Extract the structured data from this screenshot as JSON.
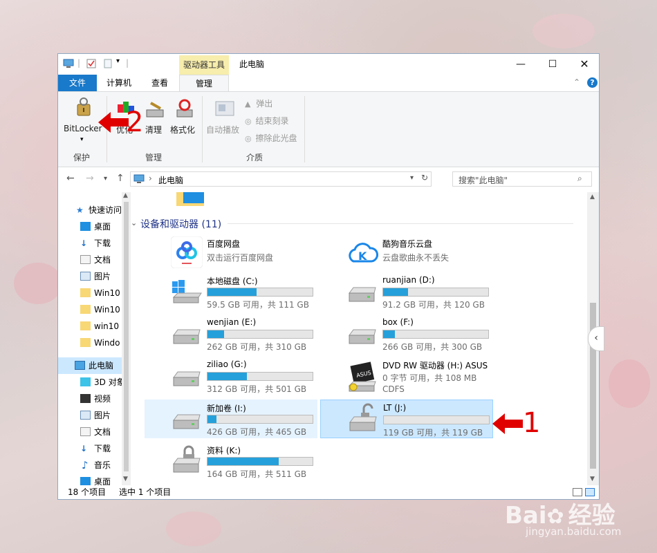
{
  "window": {
    "title": "此电脑",
    "context_tab": "驱动器工具"
  },
  "tabs": [
    {
      "label": "文件"
    },
    {
      "label": "计算机"
    },
    {
      "label": "查看"
    },
    {
      "label": "管理"
    }
  ],
  "ribbon": {
    "bitlocker": "BitLocker",
    "optimize": "优化",
    "cleanup": "清理",
    "format": "格式化",
    "autoplay": "自动播放",
    "eject": "弹出",
    "finish_burn": "结束刻录",
    "erase_disc": "擦除此光盘",
    "group_protect": "保护",
    "group_manage": "管理",
    "group_media": "介质"
  },
  "address": {
    "path": "此电脑",
    "search_placeholder": "搜索\"此电脑\""
  },
  "nav": {
    "items": [
      {
        "label": "快速访问"
      },
      {
        "label": "桌面"
      },
      {
        "label": "下载"
      },
      {
        "label": "文档"
      },
      {
        "label": "图片"
      },
      {
        "label": "Win10"
      },
      {
        "label": "Win10"
      },
      {
        "label": "win10"
      },
      {
        "label": "Windo"
      },
      {
        "label": "此电脑"
      },
      {
        "label": "3D 对象"
      },
      {
        "label": "视频"
      },
      {
        "label": "图片"
      },
      {
        "label": "文档"
      },
      {
        "label": "下载"
      },
      {
        "label": "音乐"
      },
      {
        "label": "桌面"
      }
    ]
  },
  "group": {
    "title": "设备和驱动器 (11)"
  },
  "drives": [
    {
      "name": "百度网盘",
      "sub": "双击运行百度网盘"
    },
    {
      "name": "酷狗音乐云盘",
      "sub": "云盘歌曲永不丢失"
    },
    {
      "name": "本地磁盘 (C:)",
      "sub": "59.5 GB 可用，共 111 GB",
      "used": 0.464
    },
    {
      "name": "ruanjian (D:)",
      "sub": "91.2 GB 可用，共 120 GB",
      "used": 0.24
    },
    {
      "name": "wenjian (E:)",
      "sub": "262 GB 可用，共 310 GB",
      "used": 0.155
    },
    {
      "name": "box (F:)",
      "sub": "266 GB 可用，共 300 GB",
      "used": 0.113
    },
    {
      "name": "ziliao (G:)",
      "sub": "312 GB 可用，共 501 GB",
      "used": 0.377
    },
    {
      "name": "DVD RW 驱动器 (H:) ASUS",
      "sub": "0 字节 可用，共 108 MB",
      "sub2": "CDFS"
    },
    {
      "name": "新加卷 (I:)",
      "sub": "426 GB 可用，共 465 GB",
      "used": 0.084
    },
    {
      "name": "LT (J:)",
      "sub": "119 GB 可用，共 119 GB",
      "used": 0.0
    },
    {
      "name": "资料 (K:)",
      "sub": "164 GB 可用，共 511 GB",
      "used": 0.679
    }
  ],
  "status": {
    "count": "18 个项目",
    "selected": "选中 1 个项目"
  },
  "annotations": {
    "label1": "1",
    "label2": "2"
  },
  "watermark": {
    "brand": "Bai",
    "brand2": "经验",
    "url": "jingyan.baidu.com"
  },
  "colors": {
    "accent": "#1979ca",
    "bar_fill": "#26a0da",
    "annotation": "#e00000"
  }
}
